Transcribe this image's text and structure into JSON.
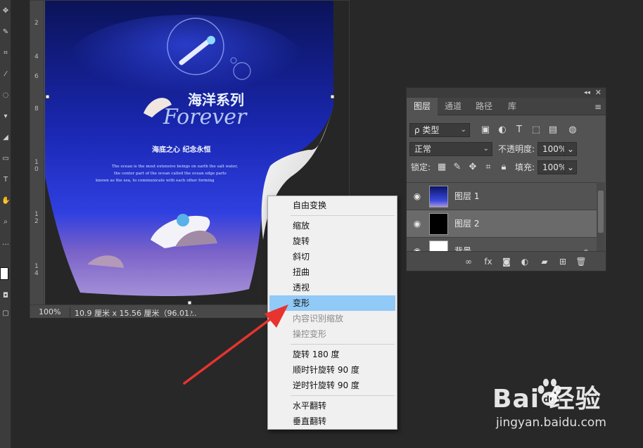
{
  "document": {
    "zoom": "100%",
    "size_info": "10.9 厘米 x 15.56 厘米（96.01...",
    "status_arrow": "›",
    "ruler_numbers": [
      "2",
      "4",
      "6",
      "8",
      "1",
      "0",
      "1",
      "2",
      "1",
      "4"
    ]
  },
  "poster": {
    "title_cn": "海洋系列",
    "title_en": "Forever",
    "slogan": "海底之心  纪念永恒",
    "body_lines": [
      "The ocean is the most extensive beings on earth the salt water,",
      "the center part of the ocean called the ocean edge parts",
      "known as the sea, to communicate with each other forming"
    ]
  },
  "layers_panel": {
    "tabs": [
      {
        "label": "图层",
        "active": true
      },
      {
        "label": "通道",
        "active": false
      },
      {
        "label": "路径",
        "active": false
      },
      {
        "label": "库",
        "active": false
      }
    ],
    "filter_label": "ρ 类型",
    "blend_mode": "正常",
    "opacity_label": "不透明度:",
    "opacity_value": "100%",
    "lock_label": "锁定:",
    "fill_label": "填充:",
    "fill_value": "100%",
    "layers": [
      {
        "name": "图层 1",
        "visible": true,
        "selected": false
      },
      {
        "name": "图层 2",
        "visible": true,
        "selected": true
      },
      {
        "name": "背景",
        "visible": true,
        "selected": false,
        "locked": true
      }
    ]
  },
  "context_menu": {
    "items": [
      {
        "label": "自由变换",
        "state": "normal"
      },
      {
        "label": "缩放",
        "state": "normal"
      },
      {
        "label": "旋转",
        "state": "normal"
      },
      {
        "label": "斜切",
        "state": "normal"
      },
      {
        "label": "扭曲",
        "state": "normal"
      },
      {
        "label": "透视",
        "state": "normal"
      },
      {
        "label": "变形",
        "state": "highlighted"
      },
      {
        "label": "内容识别缩放",
        "state": "disabled"
      },
      {
        "label": "操控变形",
        "state": "disabled"
      },
      {
        "label": "旋转 180 度",
        "state": "normal"
      },
      {
        "label": "顺时针旋转 90 度",
        "state": "normal"
      },
      {
        "label": "逆时针旋转 90 度",
        "state": "normal"
      },
      {
        "label": "水平翻转",
        "state": "normal"
      },
      {
        "label": "垂直翻转",
        "state": "normal"
      }
    ]
  },
  "watermark": {
    "brand": "Bai  经验",
    "url": "jingyan.baidu.com"
  },
  "colors": {
    "highlight": "#91c9f7",
    "arrow": "#e8332f",
    "ocean_deep": "#0c1466",
    "ocean_mid": "#2030c8"
  }
}
